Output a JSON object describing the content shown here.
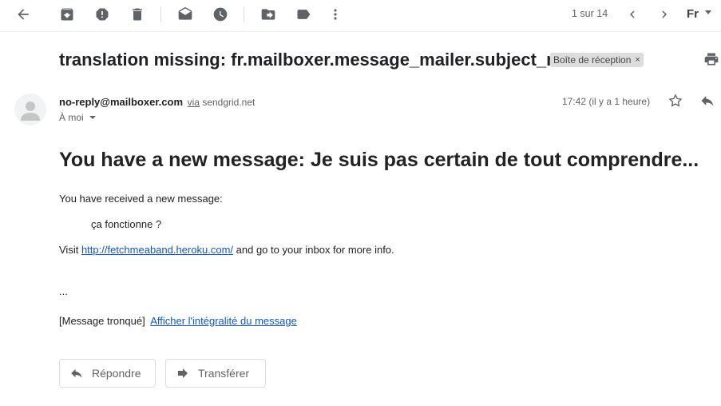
{
  "toolbar": {
    "back_icon": "arrow-left-icon",
    "archive_icon": "archive-icon",
    "spam_icon": "report-spam-icon",
    "delete_icon": "trash-icon",
    "mark_unread_icon": "envelope-open-icon",
    "snooze_icon": "clock-icon",
    "move_icon": "move-to-folder-icon",
    "label_icon": "label-icon",
    "more_icon": "more-vertical-icon",
    "pager_text": "1 sur 14",
    "language_label": "Fr"
  },
  "message": {
    "subject": "translation missing: fr.mailboxer.message_mailer.subject_new",
    "label_chip": "Boîte de réception",
    "label_chip_close": "×",
    "sender_email": "no-reply@mailboxer.com",
    "via_word": "via",
    "via_domain": "sendgrid.net",
    "recipient": "À moi",
    "timestamp": "17:42 (il y a 1 heure)"
  },
  "body": {
    "title": "You have a new message: Je suis pas certain de tout comprendre...",
    "intro": "You have received a new message:",
    "quote": "ça fonctionne ?",
    "visit_prefix": "Visit",
    "visit_link": "http://fetchmeaband.heroku.com/",
    "visit_suffix": "and go to your inbox for more info.",
    "ellipsis": "...",
    "truncated_label": "[Message tronqué]",
    "view_full_link": "Afficher l'intégralité du message"
  },
  "actions": {
    "reply_label": "Répondre",
    "forward_label": "Transférer"
  }
}
